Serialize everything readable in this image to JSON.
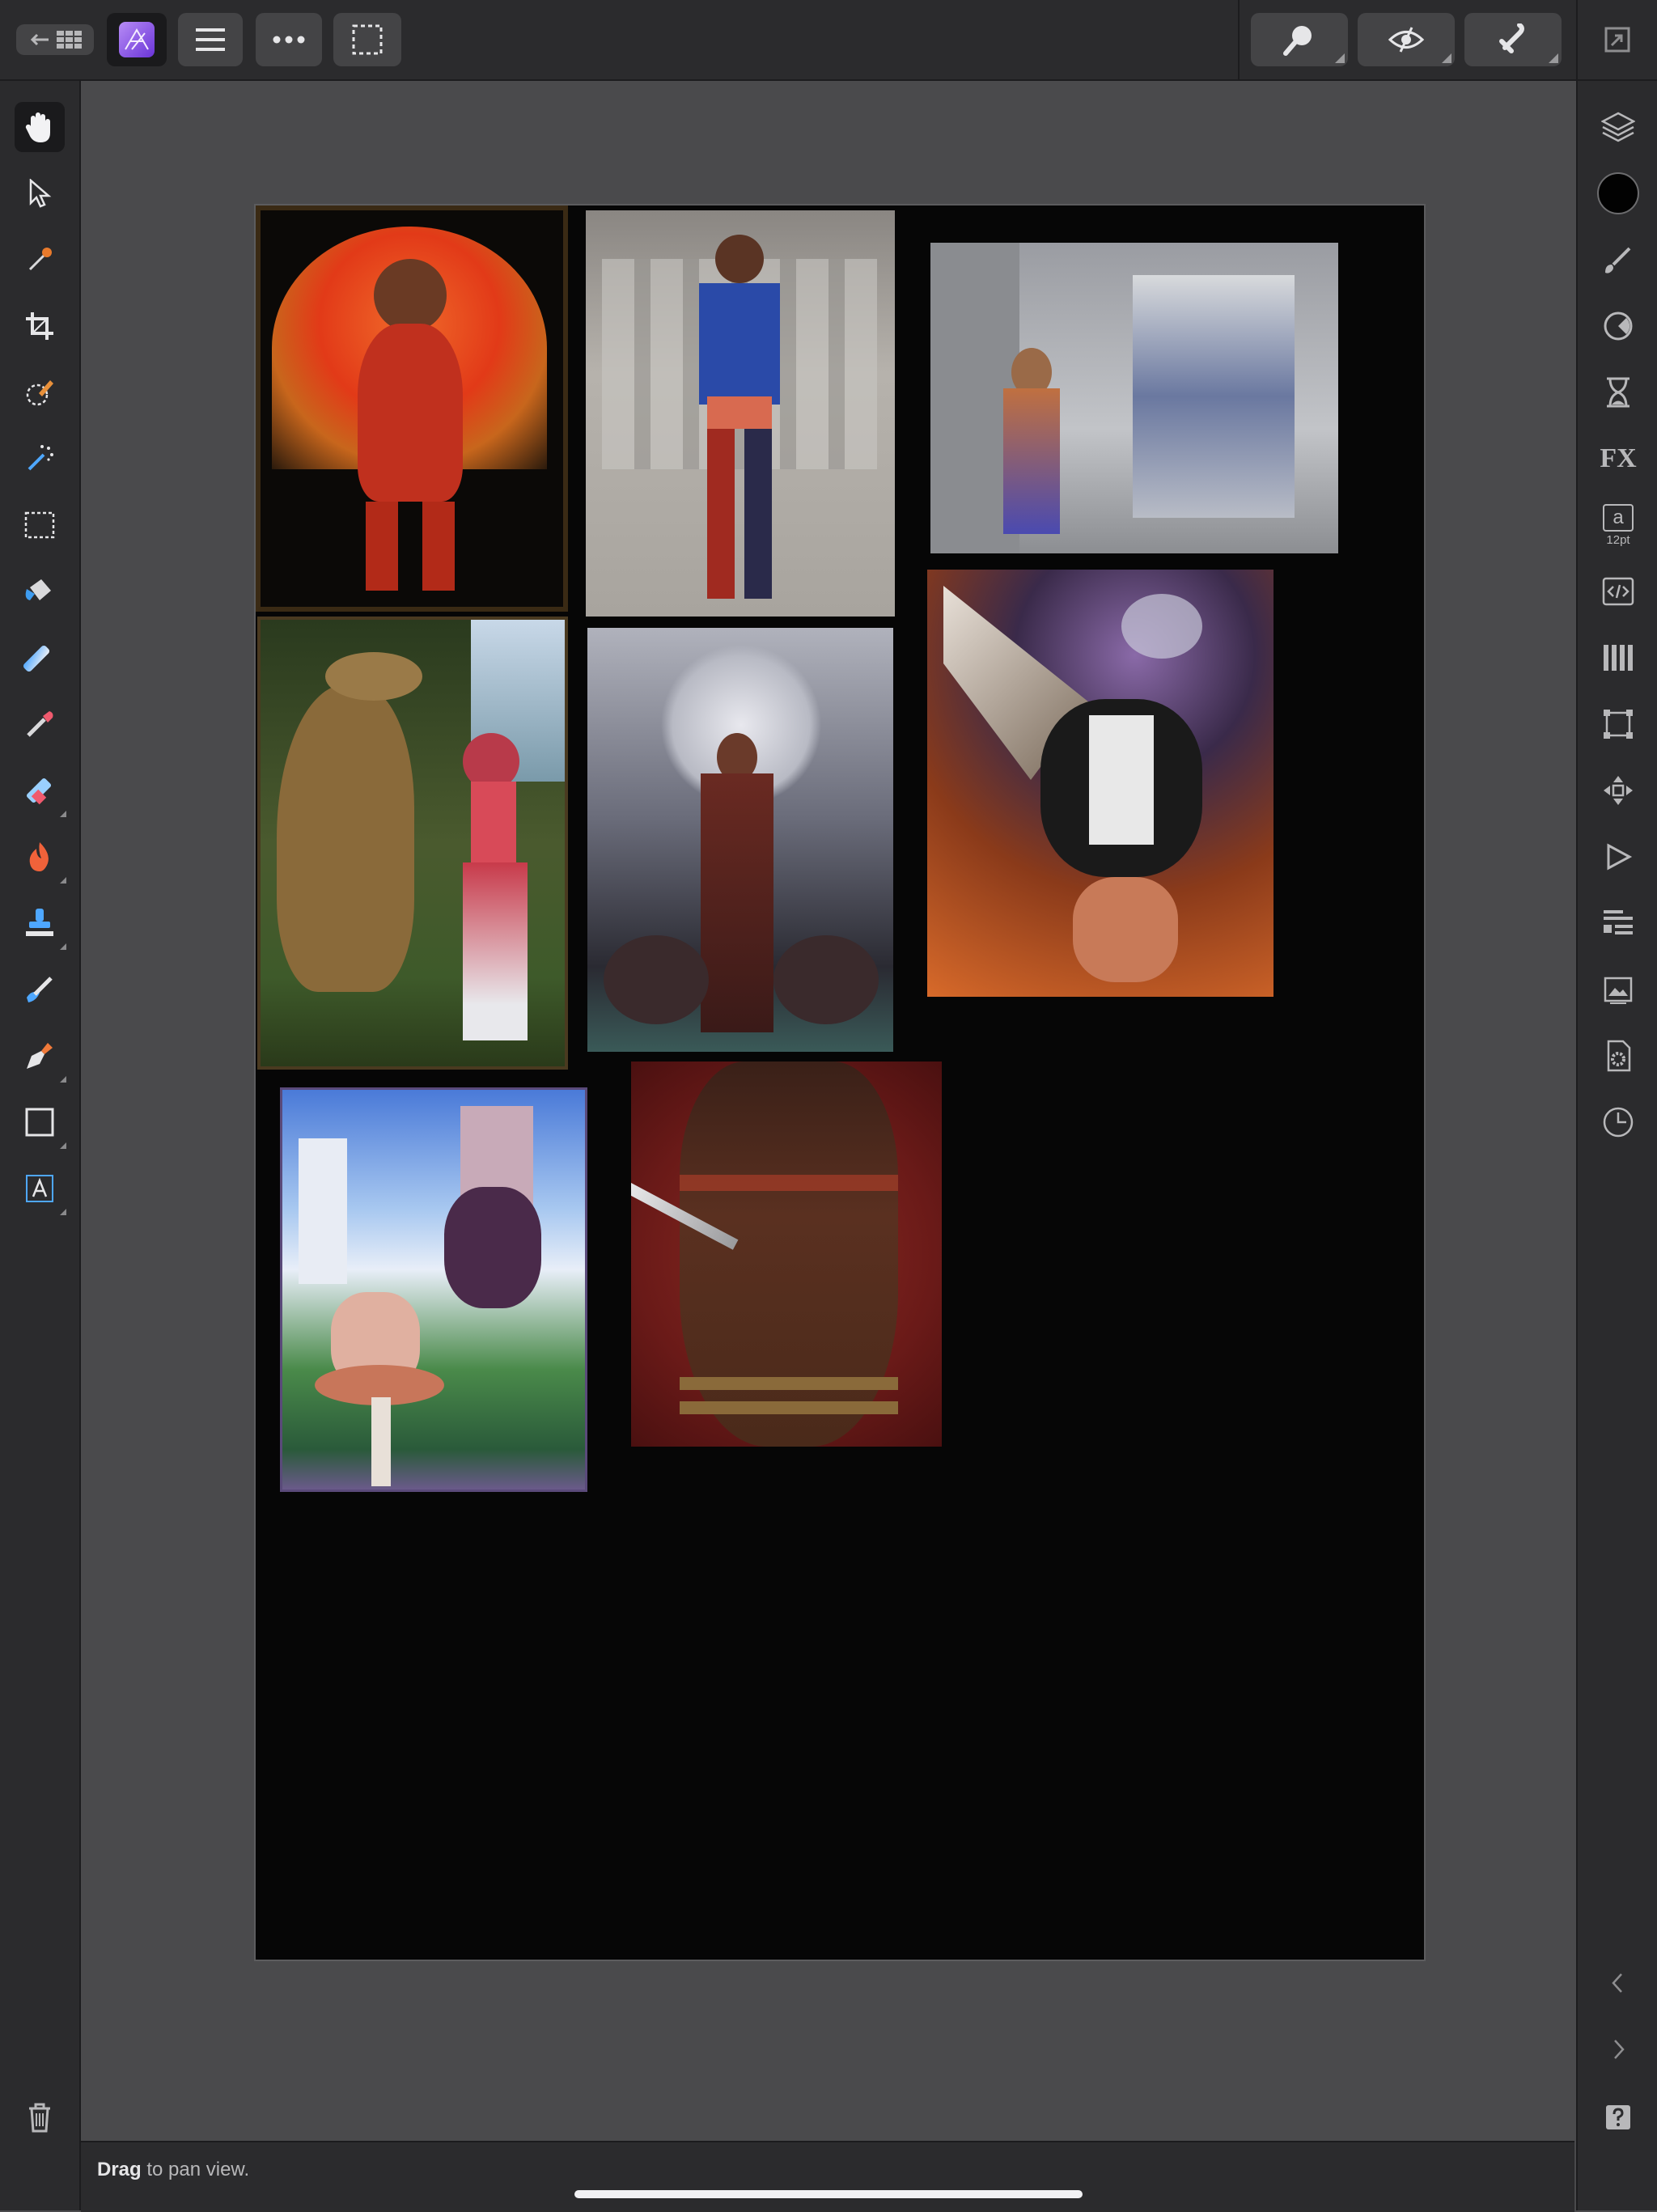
{
  "app": {
    "toolbar": {
      "back_icon": "back-arrow-icon",
      "grid_icon": "document-grid-icon",
      "app_icon": "affinity-photo-icon",
      "menu_icon": "hamburger-menu-icon",
      "more_icon": "more-dots-icon",
      "selection_icon": "selection-marquee-icon",
      "zoom_icon": "zoom-icon",
      "view_icon": "view-mode-icon",
      "snapping_icon": "snapping-magnet-icon",
      "fullscreen_icon": "fullscreen-icon"
    },
    "accent_color": "#8c5ce8"
  },
  "left_tools": [
    {
      "name": "view-tool",
      "icon": "hand-icon",
      "active": true
    },
    {
      "name": "move-tool",
      "icon": "pointer-arrow-icon"
    },
    {
      "name": "color-picker-tool",
      "icon": "eyedropper-icon"
    },
    {
      "name": "crop-tool",
      "icon": "crop-icon"
    },
    {
      "name": "selection-brush-tool",
      "icon": "selection-brush-icon"
    },
    {
      "name": "flood-select-tool",
      "icon": "magic-wand-icon"
    },
    {
      "name": "marquee-tool",
      "icon": "marquee-rect-icon"
    },
    {
      "name": "flood-fill-tool",
      "icon": "paint-bucket-icon"
    },
    {
      "name": "gradient-tool",
      "icon": "gradient-icon"
    },
    {
      "name": "paint-brush-tool",
      "icon": "paint-brush-icon"
    },
    {
      "name": "erase-brush-tool",
      "icon": "eraser-icon"
    },
    {
      "name": "dodge-burn-tool",
      "icon": "flame-icon"
    },
    {
      "name": "clone-tool",
      "icon": "stamp-icon"
    },
    {
      "name": "smudge-tool",
      "icon": "smudge-icon"
    },
    {
      "name": "pen-tool",
      "icon": "pen-nib-icon"
    },
    {
      "name": "rectangle-tool",
      "icon": "rectangle-icon"
    },
    {
      "name": "artistic-text-tool",
      "icon": "text-tool-icon"
    }
  ],
  "right_studios": [
    {
      "name": "layers-studio",
      "icon": "layers-icon"
    },
    {
      "name": "color-studio",
      "icon": "color-swatch-icon"
    },
    {
      "name": "brushes-studio",
      "icon": "brush-icon"
    },
    {
      "name": "adjustments-studio",
      "icon": "adjustment-dial-icon"
    },
    {
      "name": "history-studio",
      "icon": "hourglass-icon"
    },
    {
      "name": "effects-studio",
      "icon": "fx-icon",
      "label": "FX"
    },
    {
      "name": "character-studio",
      "icon": "character-icon",
      "label": "a",
      "sublabel": "12pt"
    },
    {
      "name": "macro-studio",
      "icon": "code-tag-icon"
    },
    {
      "name": "channels-studio",
      "icon": "channels-icon"
    },
    {
      "name": "transform-studio",
      "icon": "transform-icon"
    },
    {
      "name": "navigator-studio",
      "icon": "move-arrows-icon"
    },
    {
      "name": "play-studio",
      "icon": "play-icon"
    },
    {
      "name": "info-studio",
      "icon": "info-list-icon"
    },
    {
      "name": "stock-studio",
      "icon": "image-icon"
    },
    {
      "name": "document-settings-studio",
      "icon": "document-gear-icon"
    },
    {
      "name": "snapshots-studio",
      "icon": "clock-icon"
    }
  ],
  "bottom_controls": {
    "trash_icon": "trash-icon",
    "collapse_icon": "chevron-left-icon",
    "expand_icon": "chevron-right-icon",
    "help_icon": "help-icon"
  },
  "status": {
    "bold": "Drag",
    "rest": " to pan view."
  },
  "canvas": {
    "background": "#060606",
    "photos": [
      {
        "name": "photo-sunset-warrior"
      },
      {
        "name": "photo-superheroine"
      },
      {
        "name": "photo-corridor"
      },
      {
        "name": "photo-dinosaur-cowgirl"
      },
      {
        "name": "photo-moonlit-witch"
      },
      {
        "name": "photo-winged-creature"
      },
      {
        "name": "photo-fairy-castle"
      },
      {
        "name": "photo-sword-back"
      }
    ]
  }
}
